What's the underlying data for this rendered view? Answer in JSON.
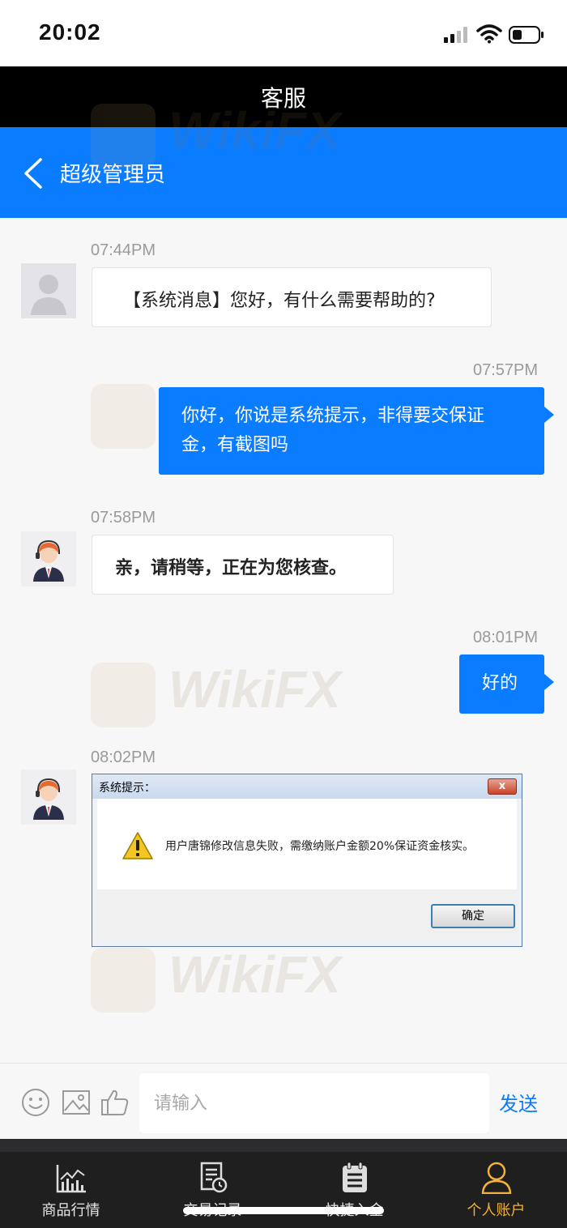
{
  "status": {
    "time": "20:02"
  },
  "title": "客服",
  "nav": {
    "name": "超级管理员"
  },
  "messages": [
    {
      "time": "07:44PM",
      "text": "【系统消息】您好，有什么需要帮助的?"
    },
    {
      "time": "07:57PM",
      "line1": "你好，你说是系统提示，非得要交保证",
      "line2": "金，有截图吗"
    },
    {
      "time": "07:58PM",
      "text": "亲，请稍等，正在为您核查。"
    },
    {
      "time": "08:01PM",
      "text": "好的"
    },
    {
      "time": "08:02PM"
    }
  ],
  "dialog": {
    "title": "系统提示：",
    "close": "x",
    "message": "用户唐锦修改信息失败，需缴纳账户金额20%保证资金核实。",
    "ok": "确定"
  },
  "input": {
    "placeholder": "请输入",
    "send": "发送"
  },
  "tabs": [
    {
      "label": "商品行情",
      "icon": "chart-icon"
    },
    {
      "label": "交易记录",
      "icon": "record-icon"
    },
    {
      "label": "快捷入金",
      "icon": "deposit-icon"
    },
    {
      "label": "个人账户",
      "icon": "user-icon"
    }
  ],
  "watermark": "WikiFX",
  "colors": {
    "brand_blue": "#0a7cff",
    "active_tab": "#f3b13a",
    "title_bg": "#000000"
  }
}
